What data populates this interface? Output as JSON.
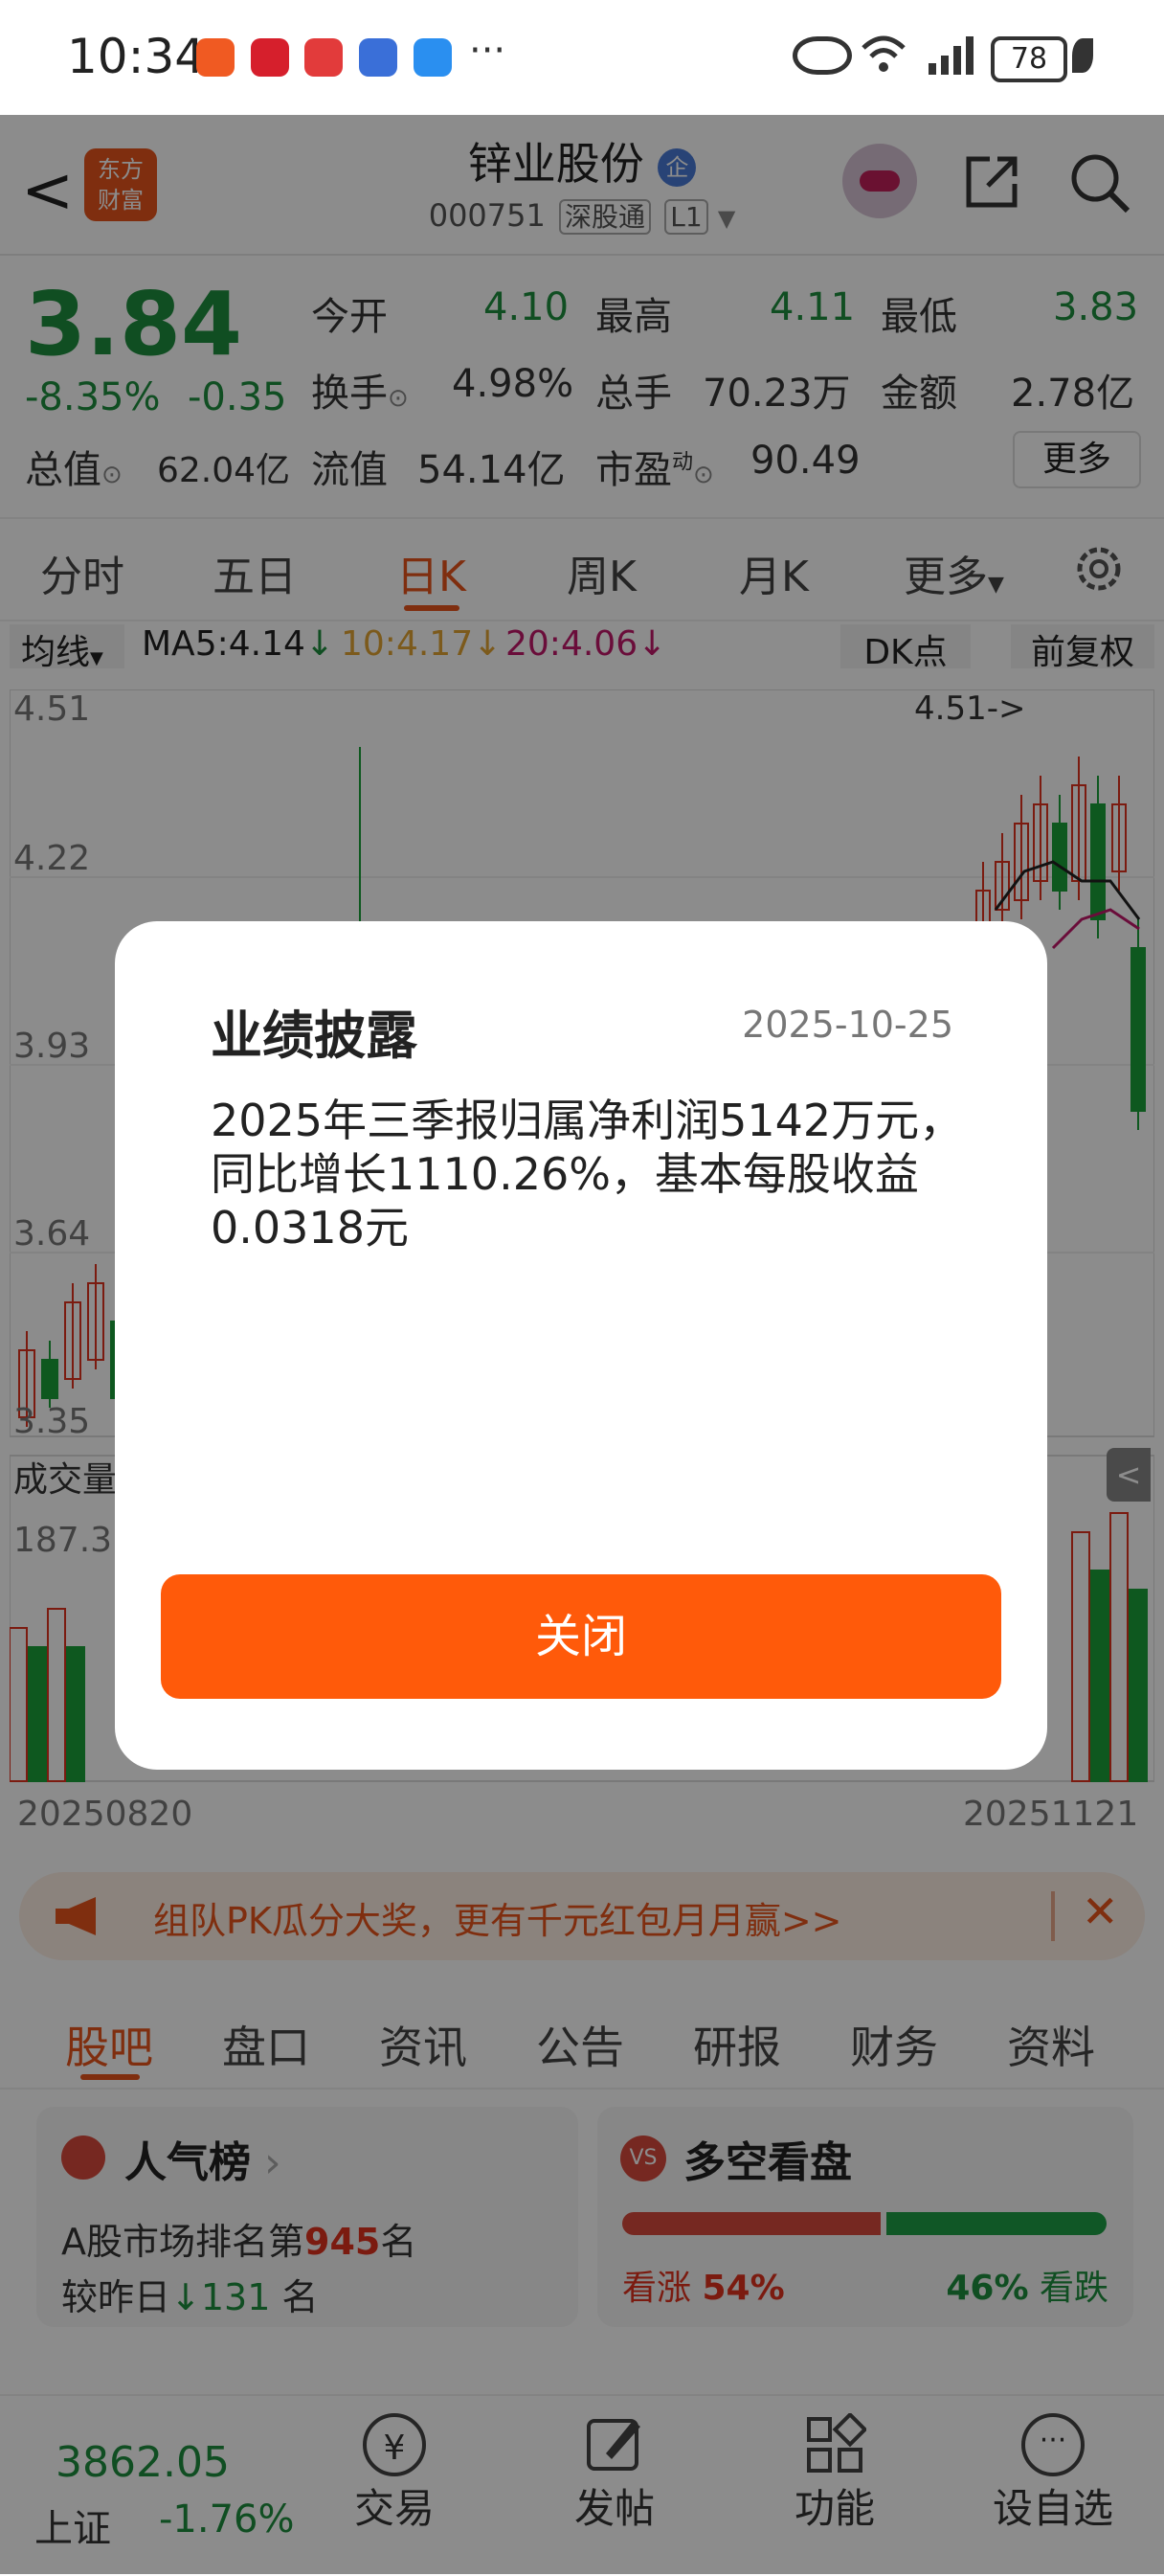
{
  "status": {
    "time": "10:34",
    "more": "···",
    "battery": "78"
  },
  "header": {
    "back_label": "<",
    "logo_text": "东方\n财富",
    "stock_name": "锌业股份",
    "badge": "企",
    "stock_code": "000751",
    "tag_market": "深股通",
    "tag_level": "L1"
  },
  "quote": {
    "price": "3.84",
    "change_pct": "-8.35%",
    "change_abs": "-0.35",
    "open_label": "今开",
    "open_value": "4.10",
    "high_label": "最高",
    "high_value": "4.11",
    "low_label": "最低",
    "low_value": "3.83",
    "turnover_label": "换手",
    "turnover_value": "4.98%",
    "volume_label": "总手",
    "volume_value": "70.23万",
    "amount_label": "金额",
    "amount_value": "2.78亿",
    "mcap_label": "总值",
    "mcap_value": "62.04亿",
    "float_label": "流值",
    "float_value": "54.14亿",
    "pe_label": "市盈",
    "pe_sup": "动",
    "pe_value": "90.49",
    "more_button": "更多"
  },
  "period_tabs": [
    "分时",
    "五日",
    "日K",
    "周K",
    "月K",
    "更多"
  ],
  "ma_bar": {
    "selector": "均线",
    "ma5": "MA5:4.14",
    "ma10": "10:4.17",
    "ma20": "20:4.06",
    "dk": "DK点",
    "adjust": "前复权"
  },
  "chart": {
    "y_labels": [
      "4.51",
      "4.22",
      "3.93",
      "3.64",
      "3.35"
    ],
    "max_marker": "4.51->",
    "volume_label": "成交量",
    "volume_value": "187.3",
    "x_start": "20250820",
    "x_end": "20251121",
    "colors": {
      "up": "#e0321e",
      "down": "#1aa13a"
    }
  },
  "chart_data": {
    "type": "candlestick",
    "ylim": [
      3.35,
      4.51
    ],
    "x_start": "20250820",
    "x_end": "20251121"
  },
  "modal": {
    "title": "业绩披露",
    "date": "2025-10-25",
    "body": "2025年三季报归属净利润5142万元，同比增长1110.26%，基本每股收益0.0318元",
    "close_button": "关闭"
  },
  "banner": {
    "text": "组队PK瓜分大奖，更有千元红包月月赢>>"
  },
  "sub_tabs": [
    "股吧",
    "盘口",
    "资讯",
    "公告",
    "研报",
    "财务",
    "资料"
  ],
  "popularity": {
    "title": "人气榜",
    "rank_prefix": "A股市场排名第",
    "rank": "945",
    "rank_suffix": "名",
    "change_prefix": "较昨日",
    "change": "131",
    "change_suffix": "名"
  },
  "sentiment": {
    "title": "多空看盘",
    "bull_label": "看涨",
    "bull_pct": "54%",
    "bear_pct": "46%",
    "bear_label": "看跌",
    "bull_fraction": 0.54
  },
  "bottom_bar": {
    "index_value": "3862.05",
    "index_name": "上证",
    "index_change": "-1.76%",
    "items": [
      "交易",
      "发帖",
      "功能",
      "设自选"
    ]
  }
}
